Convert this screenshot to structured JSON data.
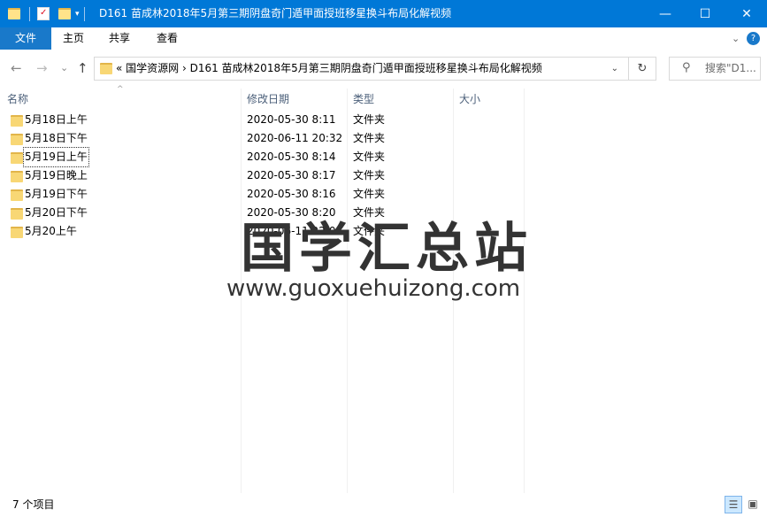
{
  "window": {
    "title": "D161 苗成林2018年5月第三期阴盘奇门遁甲面授班移星换斗布局化解视频",
    "minimize": "—",
    "maximize": "☐",
    "close": "✕"
  },
  "ribbon": {
    "file": "文件",
    "tabs": [
      "主页",
      "共享",
      "查看"
    ],
    "expand": "⌄",
    "help": "?"
  },
  "nav": {
    "back": "←",
    "forward": "→",
    "recent": "⌄",
    "up": "↑"
  },
  "address": {
    "path": "«  国学资源网  ›  D161 苗成林2018年5月第三期阴盘奇门遁甲面授班移星换斗布局化解视频",
    "dropdown": "⌄",
    "refresh": "↻"
  },
  "search": {
    "placeholder": "搜索\"D1..."
  },
  "columns": {
    "name": "名称",
    "date": "修改日期",
    "type": "类型",
    "size": "大小"
  },
  "files": [
    {
      "name": "5月18日上午",
      "date": "2020-05-30 8:11",
      "type": "文件夹"
    },
    {
      "name": "5月18日下午",
      "date": "2020-06-11 20:32",
      "type": "文件夹"
    },
    {
      "name": "5月19日上午",
      "date": "2020-05-30 8:14",
      "type": "文件夹"
    },
    {
      "name": "5月19日晚上",
      "date": "2020-05-30 8:17",
      "type": "文件夹"
    },
    {
      "name": "5月19日下午",
      "date": "2020-05-30 8:16",
      "type": "文件夹"
    },
    {
      "name": "5月20日下午",
      "date": "2020-05-30 8:20",
      "type": "文件夹"
    },
    {
      "name": "5月20上午",
      "date": "2020-06-11 22:04",
      "type": "文件夹"
    }
  ],
  "watermark": {
    "chinese": "国学汇总站",
    "url": "www.guoxuehuizong.com"
  },
  "status": {
    "count": "7 个项目"
  }
}
